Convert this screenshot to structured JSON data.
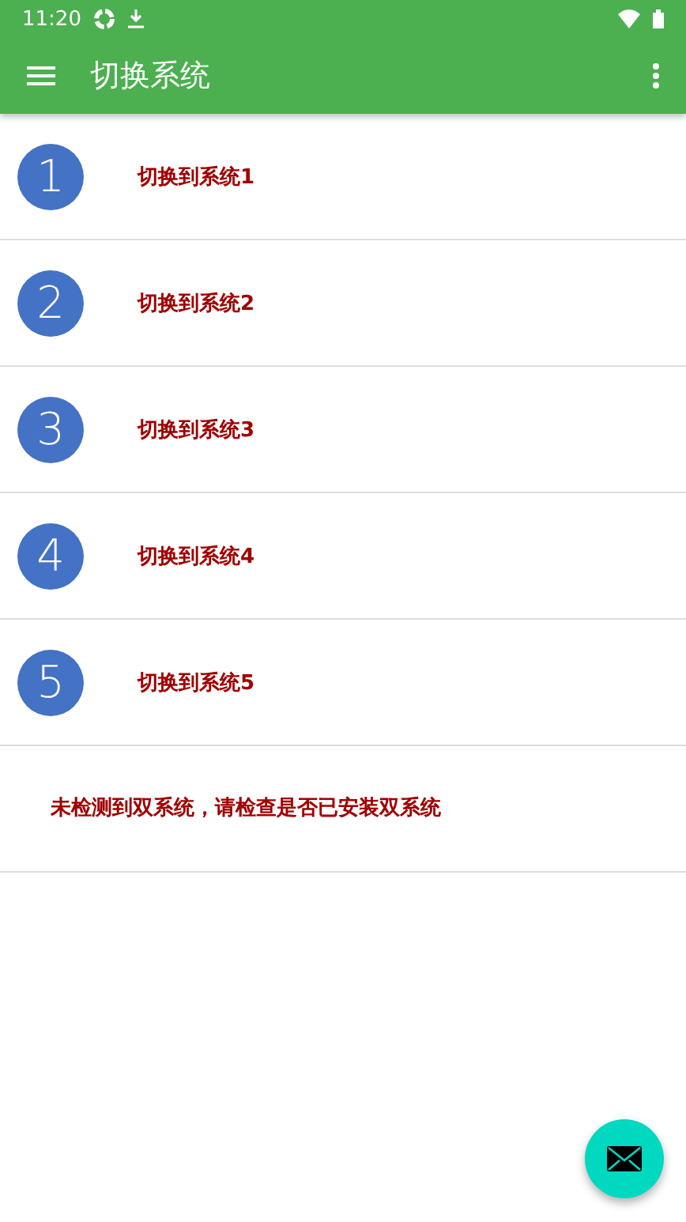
{
  "status_bar": {
    "time": "11:20"
  },
  "toolbar": {
    "title": "切换系统"
  },
  "items": [
    {
      "number": "1",
      "label": "切换到系统1"
    },
    {
      "number": "2",
      "label": "切换到系统2"
    },
    {
      "number": "3",
      "label": "切换到系统3"
    },
    {
      "number": "4",
      "label": "切换到系统4"
    },
    {
      "number": "5",
      "label": "切换到系统5"
    }
  ],
  "message": "未检测到双系统，请检查是否已安装双系统"
}
